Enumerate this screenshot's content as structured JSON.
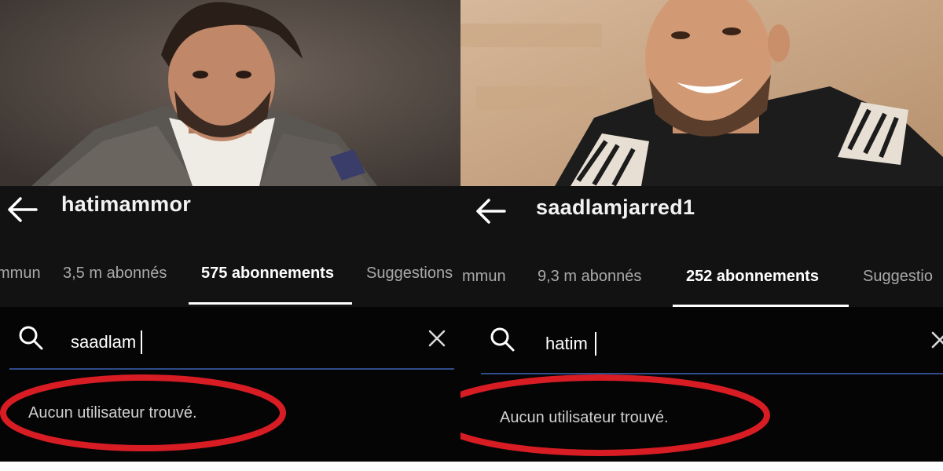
{
  "left": {
    "username": "hatimammor",
    "tabs": [
      {
        "label": "mmun"
      },
      {
        "label": "3,5 m abonnés"
      },
      {
        "label": "575 abonnements"
      },
      {
        "label": "Suggestions"
      }
    ],
    "active_tab": 2,
    "search": {
      "value": "saadlam"
    },
    "result_text": "Aucun utilisateur trouvé."
  },
  "right": {
    "username": "saadlamjarred1",
    "tabs": [
      {
        "label": "mmun"
      },
      {
        "label": "9,3 m abonnés"
      },
      {
        "label": "252 abonnements"
      },
      {
        "label": "Suggestio"
      }
    ],
    "active_tab": 2,
    "search": {
      "value": "hatim"
    },
    "result_text": "Aucun utilisateur trouvé."
  },
  "colors": {
    "background": "#121212",
    "search_background": "#050505",
    "text_primary": "#ffffff",
    "text_secondary": "#a9a9a9",
    "underline_accent": "#2f4b8a",
    "annotation_red": "#d81c24"
  },
  "icons": [
    "back-arrow-icon",
    "search-icon",
    "close-icon"
  ]
}
